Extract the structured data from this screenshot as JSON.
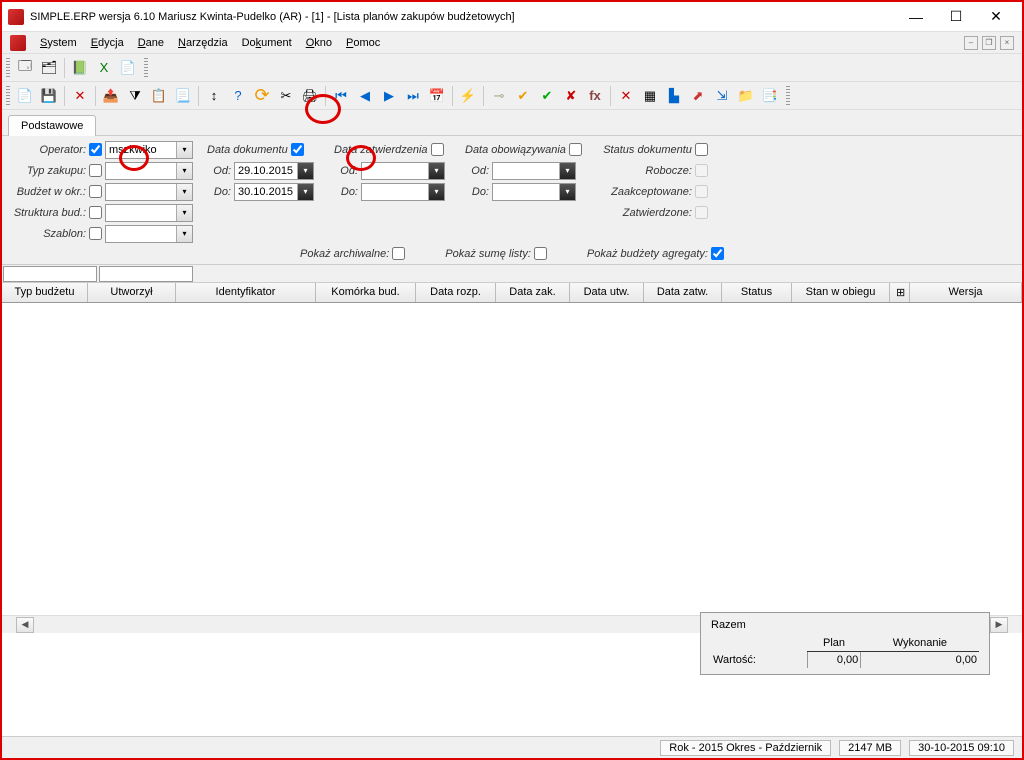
{
  "window": {
    "title": "SIMPLE.ERP wersja 6.10 Mariusz Kwinta-Pudelko (AR)  - [1]  - [Lista planów zakupów budżetowych]"
  },
  "menu": {
    "system": "System",
    "edycja": "Edycja",
    "dane": "Dane",
    "narzedzia": "Narzędzia",
    "dokument": "Dokument",
    "okno": "Okno",
    "pomoc": "Pomoc"
  },
  "tab": {
    "name": "Podstawowe"
  },
  "filters": {
    "operator_label": "Operator:",
    "operator_value": "mszkwiko",
    "typ_zakupu_label": "Typ zakupu:",
    "budzet_w_okr_label": "Budżet w okr.:",
    "struktura_bud_label": "Struktura bud.:",
    "szablon_label": "Szablon:",
    "data_dokumentu_label": "Data dokumentu",
    "od_label": "Od:",
    "do_label": "Do:",
    "od_value": "29.10.2015",
    "do_value": "30.10.2015",
    "data_zatwierdzenia_label": "Data zatwierdzenia",
    "data_obowiazywania_label": "Data obowiązywania",
    "status_dokumentu_label": "Status dokumentu",
    "robocze_label": "Robocze:",
    "zaakceptowane_label": "Zaakceptowane:",
    "zatwierdzone_label": "Zatwierdzone:",
    "pokaz_archiwalne": "Pokaż archiwalne:",
    "pokaz_sume_listy": "Pokaż sumę listy:",
    "pokaz_budzety_agregaty": "Pokaż budżety agregaty:"
  },
  "grid": {
    "columns": [
      "Typ budżetu",
      "Utworzył",
      "Identyfikator",
      "Komórka bud.",
      "Data rozp.",
      "Data zak.",
      "Data utw.",
      "Data zatw.",
      "Status",
      "Stan w obiegu",
      "",
      "Wersja"
    ]
  },
  "summary": {
    "title": "Razem",
    "plan_header": "Plan",
    "wykonanie_header": "Wykonanie",
    "wartosc_label": "Wartość:",
    "plan_value": "0,00",
    "wykonanie_value": "0,00"
  },
  "status": {
    "period": "Rok - 2015 Okres - Październik",
    "mem": "2147 MB",
    "datetime": "30-10-2015 09:10"
  }
}
